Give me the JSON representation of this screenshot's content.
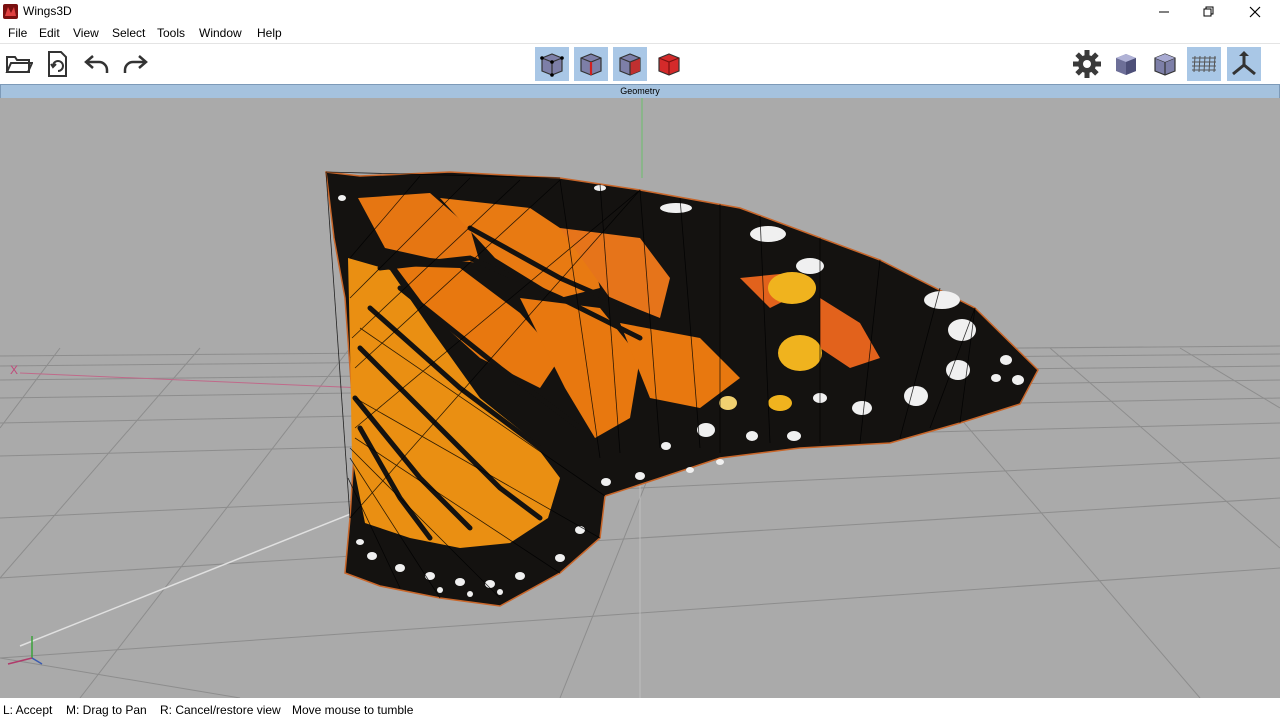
{
  "window": {
    "title": "Wings3D"
  },
  "menu": [
    "File",
    "Edit",
    "View",
    "Select",
    "Tools",
    "Window",
    "Help"
  ],
  "viewport": {
    "header": "Geometry",
    "axis_label_x": "X"
  },
  "status": {
    "left": "L: Accept",
    "middle": "M: Drag to Pan",
    "right": "R: Cancel/restore view",
    "hint": "Move mouse to tumble"
  },
  "colors": {
    "header_bg": "#a5c2de",
    "viewport_bg": "#aaaaaa",
    "selected_tool": "#a9c7e6",
    "wing_orange": "#e8780f",
    "wing_black": "#141210"
  }
}
